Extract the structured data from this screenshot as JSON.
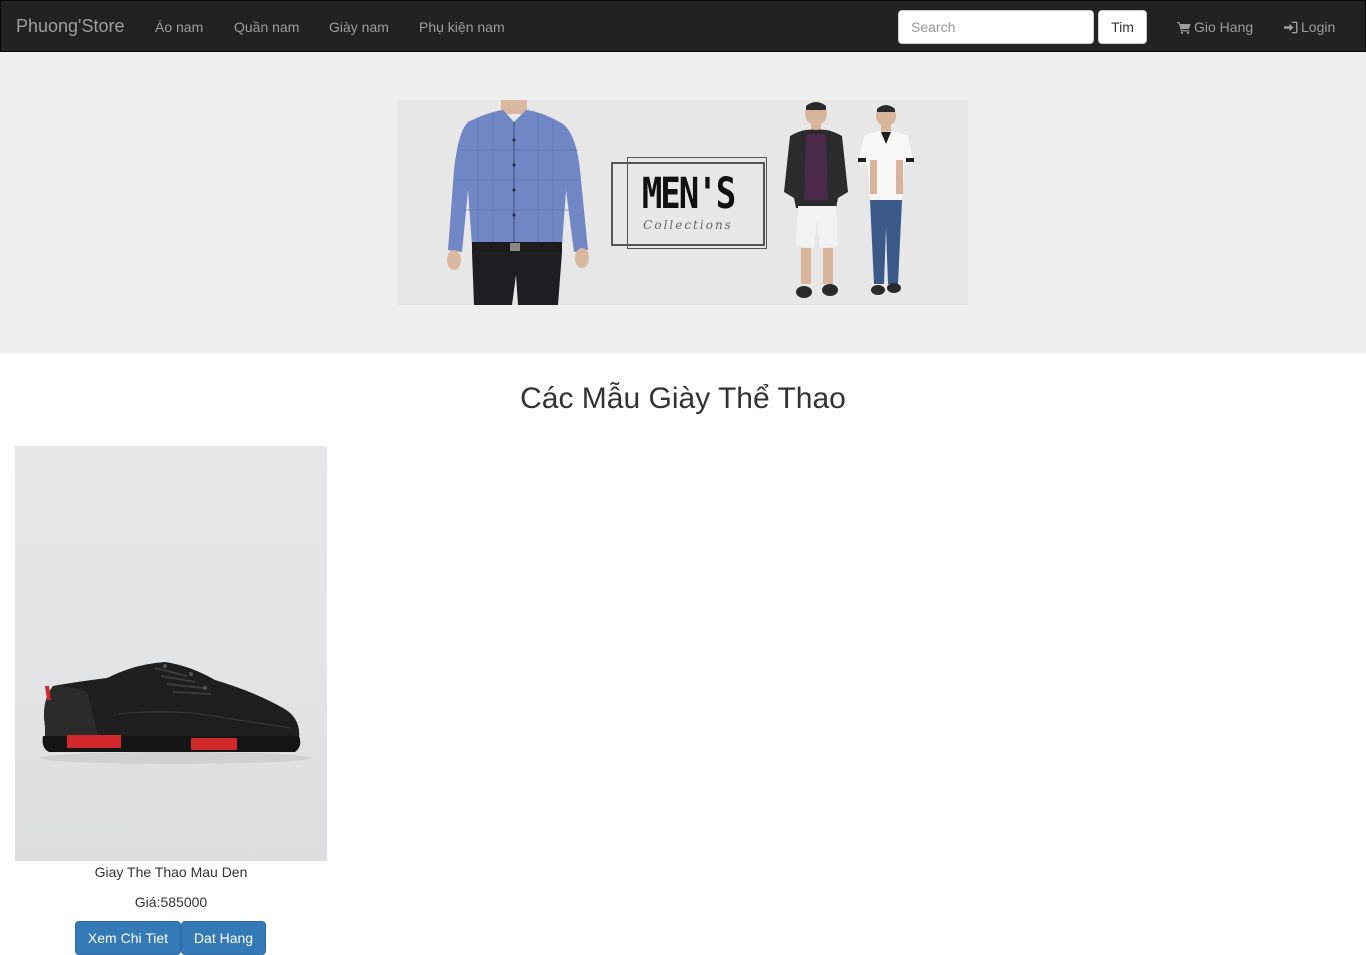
{
  "navbar": {
    "brand": "Phuong'Store",
    "links": [
      "Áo nam",
      "Quần nam",
      "Giày nam",
      "Phụ kiện nam"
    ],
    "search_placeholder": "Search",
    "search_button": "Tim",
    "cart_label": "Gio Hang",
    "login_label": "Login"
  },
  "banner": {
    "logo_title": "MEN'S",
    "logo_subtitle": "Collections"
  },
  "main": {
    "section_title": "Các Mẫu Giày Thể Thao"
  },
  "products": [
    {
      "name": "Giay The Thao Mau Den",
      "price": "Giá:585000",
      "detail_button": "Xem Chi Tiet",
      "order_button": "Dat Hang"
    }
  ],
  "colors": {
    "navbar_bg": "#222222",
    "jumbotron_bg": "#eeeeee",
    "primary_button": "#337ab7",
    "shoe_accent": "#d0282b"
  },
  "icons": {
    "cart": "shopping-cart-icon",
    "login": "log-in-icon"
  }
}
